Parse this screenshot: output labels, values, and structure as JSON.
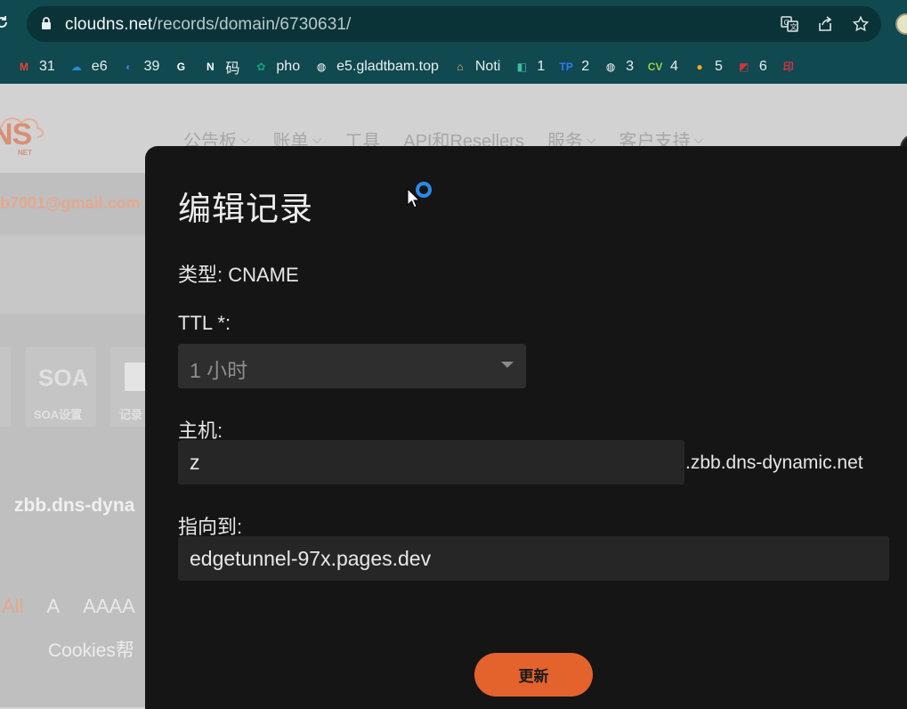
{
  "browser": {
    "url_domain": "cloudns.net",
    "url_path": "/records/domain/6730631/"
  },
  "bookmarks": [
    {
      "label": "31",
      "icon": "gmail-icon",
      "color": "#ea4335",
      "glyph": "M"
    },
    {
      "label": "e6",
      "icon": "onedrive-icon",
      "color": "#2a8ad8",
      "glyph": "☁"
    },
    {
      "label": "39",
      "icon": "linear-icon",
      "color": "#5e6ad2",
      "glyph": "◐"
    },
    {
      "label": "",
      "icon": "google-icon",
      "color": "#ffffff",
      "glyph": "G"
    },
    {
      "label": "码",
      "icon": "notion-icon",
      "color": "#ffffff",
      "glyph": "N"
    },
    {
      "label": "pho",
      "icon": "chatgpt-icon",
      "color": "#10a37f",
      "glyph": "✿"
    },
    {
      "label": "e5.gladtbam.top",
      "icon": "globe-icon",
      "color": "#ffffff",
      "glyph": "◍"
    },
    {
      "label": "Noti",
      "icon": "home-icon",
      "color": "#f2c47b",
      "glyph": "⌂"
    },
    {
      "label": "1",
      "icon": "app-icon",
      "color": "#3cbfa0",
      "glyph": "◧"
    },
    {
      "label": "2",
      "icon": "tp-icon",
      "color": "#2f7bf5",
      "glyph": "TP"
    },
    {
      "label": "3",
      "icon": "globe-icon",
      "color": "#ffffff",
      "glyph": "◍"
    },
    {
      "label": "4",
      "icon": "cv-icon",
      "color": "#9ad03a",
      "glyph": "CV"
    },
    {
      "label": "5",
      "icon": "circle-icon",
      "color": "#f5a623",
      "glyph": "●"
    },
    {
      "label": "6",
      "icon": "red-square-icon",
      "color": "#d6323f",
      "glyph": "◩"
    },
    {
      "label": "",
      "icon": "stamp-icon",
      "color": "#d6323f",
      "glyph": "印"
    }
  ],
  "site": {
    "logo_text": "NS",
    "logo_sub": "NET",
    "nav": [
      "公告板",
      "账单",
      "工具",
      "API和Resellers",
      "服务",
      "客户支持"
    ],
    "nav_has_dropdown": [
      true,
      true,
      false,
      false,
      true,
      true
    ],
    "email": "b7001@gmail.com",
    "soa_big": "SOA",
    "soa_label": "SOA设置",
    "records_label": "记录",
    "domain_partial": "zbb.dns-dyna",
    "filters": [
      "All",
      "A",
      "AAAA"
    ],
    "cookies_text": "Cookies帮"
  },
  "modal": {
    "title": "编辑记录",
    "type_label": "类型: CNAME",
    "ttl_label": "TTL *:",
    "ttl_value": "1 小时",
    "host_label": "主机:",
    "host_value": "z",
    "host_suffix": ".zbb.dns-dynamic.net",
    "target_label": "指向到:",
    "target_value": "edgetunnel-97x.pages.dev",
    "submit_label": "更新"
  },
  "colors": {
    "chrome": "#10494f",
    "accent": "#e4622c",
    "modal_bg": "#151515"
  }
}
